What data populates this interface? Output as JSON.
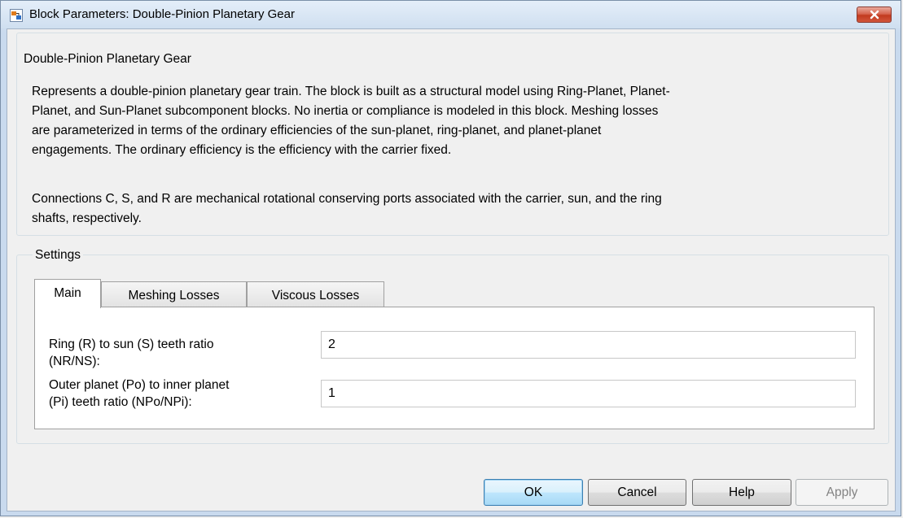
{
  "window": {
    "title": "Block Parameters: Double-Pinion Planetary Gear"
  },
  "description": {
    "group_title": "Double-Pinion Planetary Gear",
    "lines": [
      "Represents a double-pinion planetary gear train. The block is built as a structural model using Ring-Planet, Planet-",
      "Planet, and Sun-Planet subcomponent blocks. No inertia or compliance is modeled in this block. Meshing losses",
      "are parameterized in terms of the ordinary efficiencies of the sun-planet, ring-planet, and planet-planet",
      "engagements. The ordinary efficiency is the efficiency with the carrier fixed.",
      "Connections C, S, and R are mechanical rotational conserving ports associated with the carrier, sun, and the ring",
      "shafts, respectively."
    ]
  },
  "settings": {
    "group_title": "Settings",
    "tabs": [
      {
        "label": "Main",
        "active": true
      },
      {
        "label": "Meshing Losses",
        "active": false
      },
      {
        "label": "Viscous Losses",
        "active": false
      }
    ],
    "params": [
      {
        "label_line1": "Ring (R) to sun (S) teeth ratio",
        "label_line2": "(NR/NS):",
        "value": "2"
      },
      {
        "label_line1": "Outer planet (Po) to inner planet",
        "label_line2": "(Pi) teeth ratio (NPo/NPi):",
        "value": "1"
      }
    ]
  },
  "buttons": {
    "ok": "OK",
    "cancel": "Cancel",
    "help": "Help",
    "apply": "Apply"
  },
  "colors": {
    "close_button": "#c9432a",
    "default_button_border": "#3c7fb1"
  }
}
